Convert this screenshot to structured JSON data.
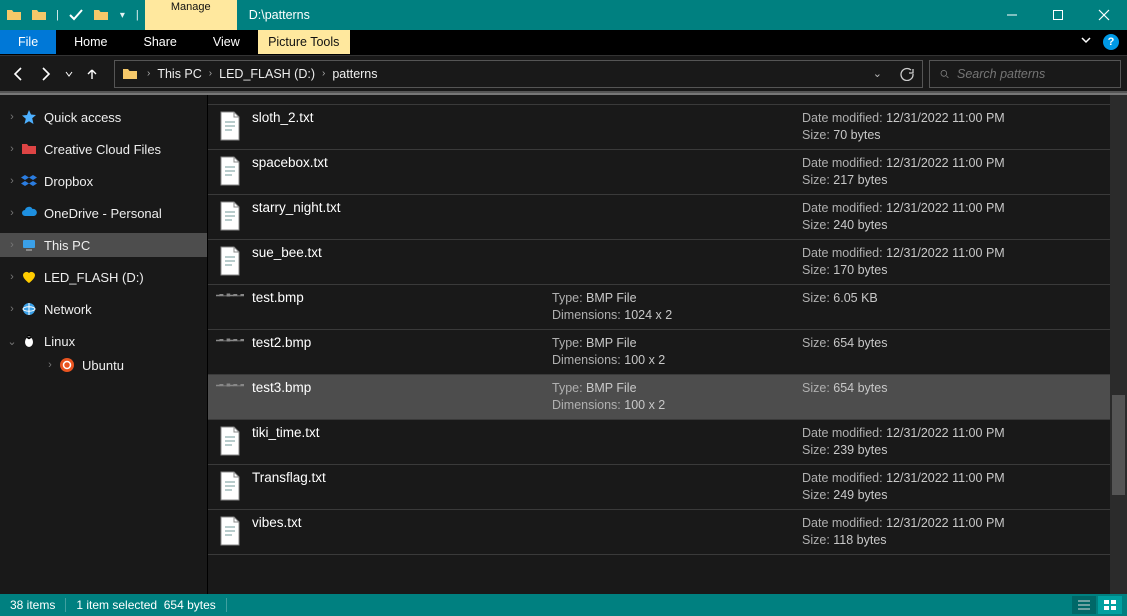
{
  "window": {
    "ctx_tab_title": "Manage",
    "ctx_tab_sub": "Picture Tools",
    "title": "D:\\patterns"
  },
  "ribbon": {
    "file": "File",
    "tabs": [
      "Home",
      "Share",
      "View"
    ]
  },
  "breadcrumb": {
    "items": [
      "This PC",
      "LED_FLASH (D:)",
      "patterns"
    ]
  },
  "search": {
    "placeholder": "Search patterns"
  },
  "tree": [
    {
      "kind": "item",
      "exp": "›",
      "icon": "star",
      "label": "Quick access",
      "indent": 0
    },
    {
      "kind": "gap"
    },
    {
      "kind": "item",
      "exp": "›",
      "icon": "cc",
      "label": "Creative Cloud Files",
      "indent": 0
    },
    {
      "kind": "gap"
    },
    {
      "kind": "item",
      "exp": "›",
      "icon": "dropbox",
      "label": "Dropbox",
      "indent": 0
    },
    {
      "kind": "gap"
    },
    {
      "kind": "item",
      "exp": "›",
      "icon": "onedrive",
      "label": "OneDrive - Personal",
      "indent": 0
    },
    {
      "kind": "gap"
    },
    {
      "kind": "item",
      "exp": "›",
      "icon": "thispc",
      "label": "This PC",
      "indent": 0,
      "selected": true
    },
    {
      "kind": "gap"
    },
    {
      "kind": "item",
      "exp": "›",
      "icon": "heart",
      "label": "LED_FLASH (D:)",
      "indent": 0
    },
    {
      "kind": "gap"
    },
    {
      "kind": "item",
      "exp": "›",
      "icon": "network",
      "label": "Network",
      "indent": 0
    },
    {
      "kind": "gap"
    },
    {
      "kind": "item",
      "exp": "⌄",
      "icon": "linux",
      "label": "Linux",
      "indent": 0
    },
    {
      "kind": "item",
      "exp": "›",
      "icon": "ubuntu",
      "label": "Ubuntu",
      "indent": 2
    }
  ],
  "files": [
    {
      "name": "sloth_2.txt",
      "icon": "txt",
      "mid": {},
      "right": {
        "Date modified": "12/31/2022 11:00 PM",
        "Size": "70 bytes"
      }
    },
    {
      "name": "spacebox.txt",
      "icon": "txt",
      "mid": {},
      "right": {
        "Date modified": "12/31/2022 11:00 PM",
        "Size": "217 bytes"
      }
    },
    {
      "name": "starry_night.txt",
      "icon": "txt",
      "mid": {},
      "right": {
        "Date modified": "12/31/2022 11:00 PM",
        "Size": "240 bytes"
      }
    },
    {
      "name": "sue_bee.txt",
      "icon": "txt",
      "mid": {},
      "right": {
        "Date modified": "12/31/2022 11:00 PM",
        "Size": "170 bytes"
      }
    },
    {
      "name": "test.bmp",
      "icon": "bmp",
      "mid": {
        "Type": "BMP File",
        "Dimensions": "1024 x 2"
      },
      "right": {
        "Size": "6.05 KB"
      }
    },
    {
      "name": "test2.bmp",
      "icon": "bmp",
      "mid": {
        "Type": "BMP File",
        "Dimensions": "100 x 2"
      },
      "right": {
        "Size": "654 bytes"
      }
    },
    {
      "name": "test3.bmp",
      "icon": "bmp",
      "mid": {
        "Type": "BMP File",
        "Dimensions": "100 x 2"
      },
      "right": {
        "Size": "654 bytes"
      },
      "selected": true
    },
    {
      "name": "tiki_time.txt",
      "icon": "txt",
      "mid": {},
      "right": {
        "Date modified": "12/31/2022 11:00 PM",
        "Size": "239 bytes"
      }
    },
    {
      "name": "Transflag.txt",
      "icon": "txt",
      "mid": {},
      "right": {
        "Date modified": "12/31/2022 11:00 PM",
        "Size": "249 bytes"
      }
    },
    {
      "name": "vibes.txt",
      "icon": "txt",
      "mid": {},
      "right": {
        "Date modified": "12/31/2022 11:00 PM",
        "Size": "118 bytes"
      }
    }
  ],
  "status": {
    "count": "38 items",
    "selection": "1 item selected",
    "sel_size": "654 bytes"
  }
}
